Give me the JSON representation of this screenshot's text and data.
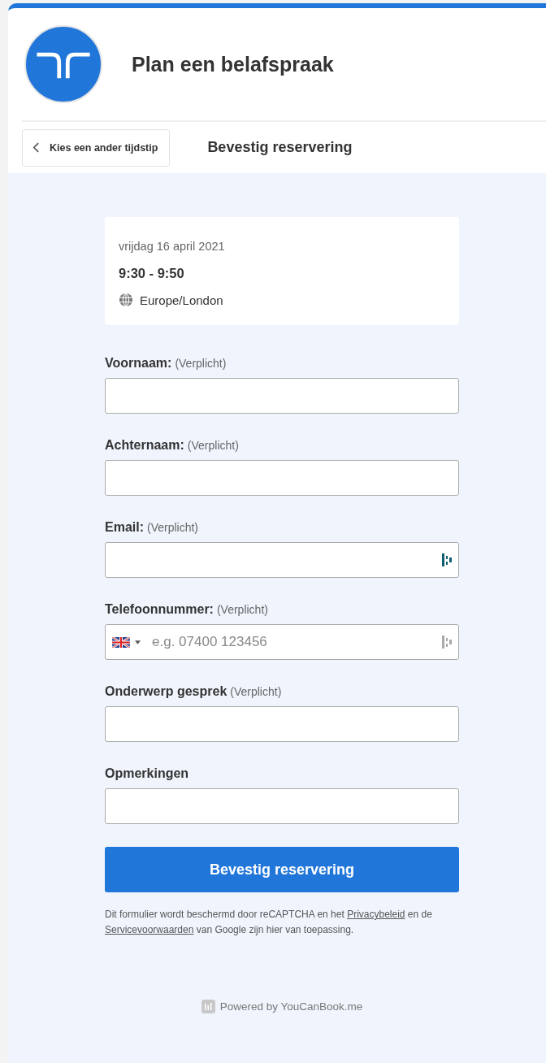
{
  "header": {
    "title": "Plan een belafspraak"
  },
  "nav": {
    "back_button": "Kies een ander tijdstip",
    "title": "Bevestig reservering"
  },
  "summary": {
    "date": "vrijdag 16 april 2021",
    "time": "9:30 - 9:50",
    "timezone": "Europe/London"
  },
  "fields": [
    {
      "kind": "text",
      "label": "Voornaam:",
      "note": "(Verplicht)"
    },
    {
      "kind": "text",
      "label": "Achternaam:",
      "note": "(Verplicht)"
    },
    {
      "kind": "text",
      "label": "Email:",
      "note": "(Verplicht)",
      "autofill_active": true
    },
    {
      "kind": "phone",
      "label": "Telefoonnummer:",
      "note": "(Verplicht)",
      "placeholder": "e.g. 07400 123456",
      "autofill_active": false
    },
    {
      "kind": "text",
      "label": "Onderwerp gesprek",
      "note": "(Verplicht)"
    },
    {
      "kind": "text",
      "label": "Opmerkingen"
    }
  ],
  "submit_button": "Bevestig reservering",
  "notice": [
    {
      "kind": "text",
      "text": "Dit formulier wordt beschermd door reCAPTCHA en het"
    },
    {
      "kind": "link",
      "text": "Privacybeleid"
    },
    {
      "kind": "text",
      "text": "en de"
    },
    {
      "kind": "link",
      "text": "Servicevoorwaarden"
    },
    {
      "kind": "text",
      "text": "van Google zijn hier van toepassing."
    }
  ],
  "footer": "Powered by YouCanBook.me"
}
